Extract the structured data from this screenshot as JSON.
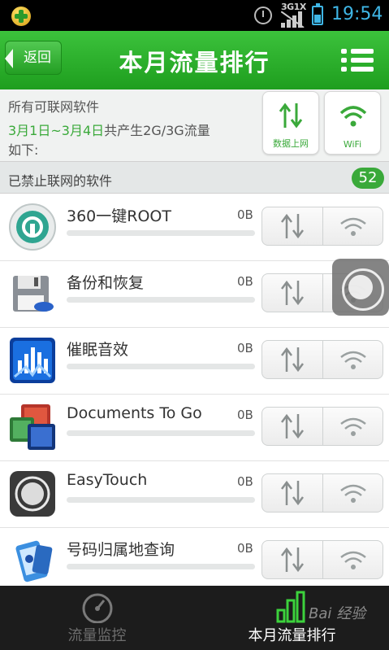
{
  "status_bar": {
    "network": "3G1X",
    "time": "19:54"
  },
  "header": {
    "back_label": "返回",
    "title": "本月流量排行"
  },
  "summary": {
    "line1": "所有可联网软件",
    "date_range": "3月1日~3月4日",
    "line2_rest": "共产生2G/3G流量",
    "line3": "如下:",
    "data_button_label": "数据上网",
    "wifi_button_label": "WiFi"
  },
  "section": {
    "title": "已禁止联网的软件",
    "count": "52"
  },
  "apps": [
    {
      "name": "360一键ROOT",
      "bytes": "0B",
      "icon": "360-root-icon"
    },
    {
      "name": "备份和恢复",
      "bytes": "0B",
      "icon": "backup-restore-icon"
    },
    {
      "name": "催眠音效",
      "bytes": "0B",
      "icon": "hypnosis-sound-icon"
    },
    {
      "name": "Documents To Go",
      "bytes": "0B",
      "icon": "documents-to-go-icon"
    },
    {
      "name": "EasyTouch",
      "bytes": "0B",
      "icon": "easytouch-icon"
    },
    {
      "name": "号码归属地查询",
      "bytes": "0B",
      "icon": "phone-location-icon"
    }
  ],
  "bottom_nav": {
    "tab1_label": "流量监控",
    "tab2_label": "本月流量排行"
  },
  "watermark": "Bai 经验",
  "colors": {
    "brand_green": "#2aa82a",
    "status_blue": "#3fb6e6",
    "nav_bg": "#1c1c1c"
  }
}
